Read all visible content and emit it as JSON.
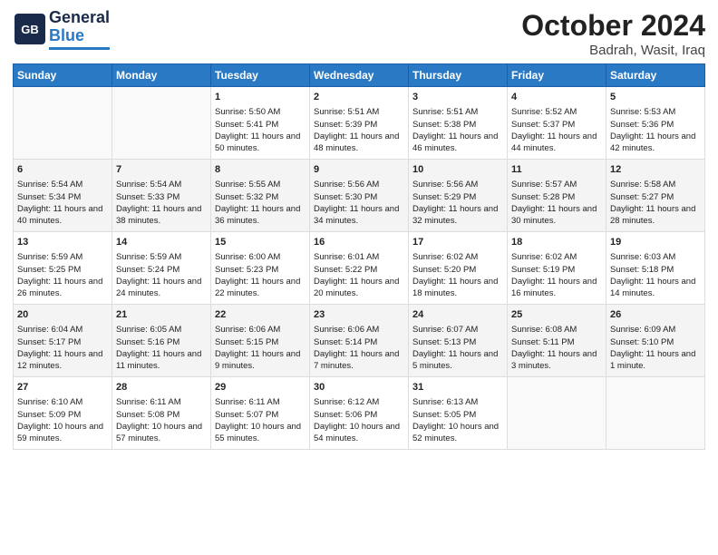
{
  "header": {
    "logo_general": "General",
    "logo_blue": "Blue",
    "month": "October 2024",
    "location": "Badrah, Wasit, Iraq"
  },
  "weekdays": [
    "Sunday",
    "Monday",
    "Tuesday",
    "Wednesday",
    "Thursday",
    "Friday",
    "Saturday"
  ],
  "rows": [
    [
      {
        "day": "",
        "sunrise": "",
        "sunset": "",
        "daylight": ""
      },
      {
        "day": "",
        "sunrise": "",
        "sunset": "",
        "daylight": ""
      },
      {
        "day": "1",
        "sunrise": "Sunrise: 5:50 AM",
        "sunset": "Sunset: 5:41 PM",
        "daylight": "Daylight: 11 hours and 50 minutes."
      },
      {
        "day": "2",
        "sunrise": "Sunrise: 5:51 AM",
        "sunset": "Sunset: 5:39 PM",
        "daylight": "Daylight: 11 hours and 48 minutes."
      },
      {
        "day": "3",
        "sunrise": "Sunrise: 5:51 AM",
        "sunset": "Sunset: 5:38 PM",
        "daylight": "Daylight: 11 hours and 46 minutes."
      },
      {
        "day": "4",
        "sunrise": "Sunrise: 5:52 AM",
        "sunset": "Sunset: 5:37 PM",
        "daylight": "Daylight: 11 hours and 44 minutes."
      },
      {
        "day": "5",
        "sunrise": "Sunrise: 5:53 AM",
        "sunset": "Sunset: 5:36 PM",
        "daylight": "Daylight: 11 hours and 42 minutes."
      }
    ],
    [
      {
        "day": "6",
        "sunrise": "Sunrise: 5:54 AM",
        "sunset": "Sunset: 5:34 PM",
        "daylight": "Daylight: 11 hours and 40 minutes."
      },
      {
        "day": "7",
        "sunrise": "Sunrise: 5:54 AM",
        "sunset": "Sunset: 5:33 PM",
        "daylight": "Daylight: 11 hours and 38 minutes."
      },
      {
        "day": "8",
        "sunrise": "Sunrise: 5:55 AM",
        "sunset": "Sunset: 5:32 PM",
        "daylight": "Daylight: 11 hours and 36 minutes."
      },
      {
        "day": "9",
        "sunrise": "Sunrise: 5:56 AM",
        "sunset": "Sunset: 5:30 PM",
        "daylight": "Daylight: 11 hours and 34 minutes."
      },
      {
        "day": "10",
        "sunrise": "Sunrise: 5:56 AM",
        "sunset": "Sunset: 5:29 PM",
        "daylight": "Daylight: 11 hours and 32 minutes."
      },
      {
        "day": "11",
        "sunrise": "Sunrise: 5:57 AM",
        "sunset": "Sunset: 5:28 PM",
        "daylight": "Daylight: 11 hours and 30 minutes."
      },
      {
        "day": "12",
        "sunrise": "Sunrise: 5:58 AM",
        "sunset": "Sunset: 5:27 PM",
        "daylight": "Daylight: 11 hours and 28 minutes."
      }
    ],
    [
      {
        "day": "13",
        "sunrise": "Sunrise: 5:59 AM",
        "sunset": "Sunset: 5:25 PM",
        "daylight": "Daylight: 11 hours and 26 minutes."
      },
      {
        "day": "14",
        "sunrise": "Sunrise: 5:59 AM",
        "sunset": "Sunset: 5:24 PM",
        "daylight": "Daylight: 11 hours and 24 minutes."
      },
      {
        "day": "15",
        "sunrise": "Sunrise: 6:00 AM",
        "sunset": "Sunset: 5:23 PM",
        "daylight": "Daylight: 11 hours and 22 minutes."
      },
      {
        "day": "16",
        "sunrise": "Sunrise: 6:01 AM",
        "sunset": "Sunset: 5:22 PM",
        "daylight": "Daylight: 11 hours and 20 minutes."
      },
      {
        "day": "17",
        "sunrise": "Sunrise: 6:02 AM",
        "sunset": "Sunset: 5:20 PM",
        "daylight": "Daylight: 11 hours and 18 minutes."
      },
      {
        "day": "18",
        "sunrise": "Sunrise: 6:02 AM",
        "sunset": "Sunset: 5:19 PM",
        "daylight": "Daylight: 11 hours and 16 minutes."
      },
      {
        "day": "19",
        "sunrise": "Sunrise: 6:03 AM",
        "sunset": "Sunset: 5:18 PM",
        "daylight": "Daylight: 11 hours and 14 minutes."
      }
    ],
    [
      {
        "day": "20",
        "sunrise": "Sunrise: 6:04 AM",
        "sunset": "Sunset: 5:17 PM",
        "daylight": "Daylight: 11 hours and 12 minutes."
      },
      {
        "day": "21",
        "sunrise": "Sunrise: 6:05 AM",
        "sunset": "Sunset: 5:16 PM",
        "daylight": "Daylight: 11 hours and 11 minutes."
      },
      {
        "day": "22",
        "sunrise": "Sunrise: 6:06 AM",
        "sunset": "Sunset: 5:15 PM",
        "daylight": "Daylight: 11 hours and 9 minutes."
      },
      {
        "day": "23",
        "sunrise": "Sunrise: 6:06 AM",
        "sunset": "Sunset: 5:14 PM",
        "daylight": "Daylight: 11 hours and 7 minutes."
      },
      {
        "day": "24",
        "sunrise": "Sunrise: 6:07 AM",
        "sunset": "Sunset: 5:13 PM",
        "daylight": "Daylight: 11 hours and 5 minutes."
      },
      {
        "day": "25",
        "sunrise": "Sunrise: 6:08 AM",
        "sunset": "Sunset: 5:11 PM",
        "daylight": "Daylight: 11 hours and 3 minutes."
      },
      {
        "day": "26",
        "sunrise": "Sunrise: 6:09 AM",
        "sunset": "Sunset: 5:10 PM",
        "daylight": "Daylight: 11 hours and 1 minute."
      }
    ],
    [
      {
        "day": "27",
        "sunrise": "Sunrise: 6:10 AM",
        "sunset": "Sunset: 5:09 PM",
        "daylight": "Daylight: 10 hours and 59 minutes."
      },
      {
        "day": "28",
        "sunrise": "Sunrise: 6:11 AM",
        "sunset": "Sunset: 5:08 PM",
        "daylight": "Daylight: 10 hours and 57 minutes."
      },
      {
        "day": "29",
        "sunrise": "Sunrise: 6:11 AM",
        "sunset": "Sunset: 5:07 PM",
        "daylight": "Daylight: 10 hours and 55 minutes."
      },
      {
        "day": "30",
        "sunrise": "Sunrise: 6:12 AM",
        "sunset": "Sunset: 5:06 PM",
        "daylight": "Daylight: 10 hours and 54 minutes."
      },
      {
        "day": "31",
        "sunrise": "Sunrise: 6:13 AM",
        "sunset": "Sunset: 5:05 PM",
        "daylight": "Daylight: 10 hours and 52 minutes."
      },
      {
        "day": "",
        "sunrise": "",
        "sunset": "",
        "daylight": ""
      },
      {
        "day": "",
        "sunrise": "",
        "sunset": "",
        "daylight": ""
      }
    ]
  ]
}
